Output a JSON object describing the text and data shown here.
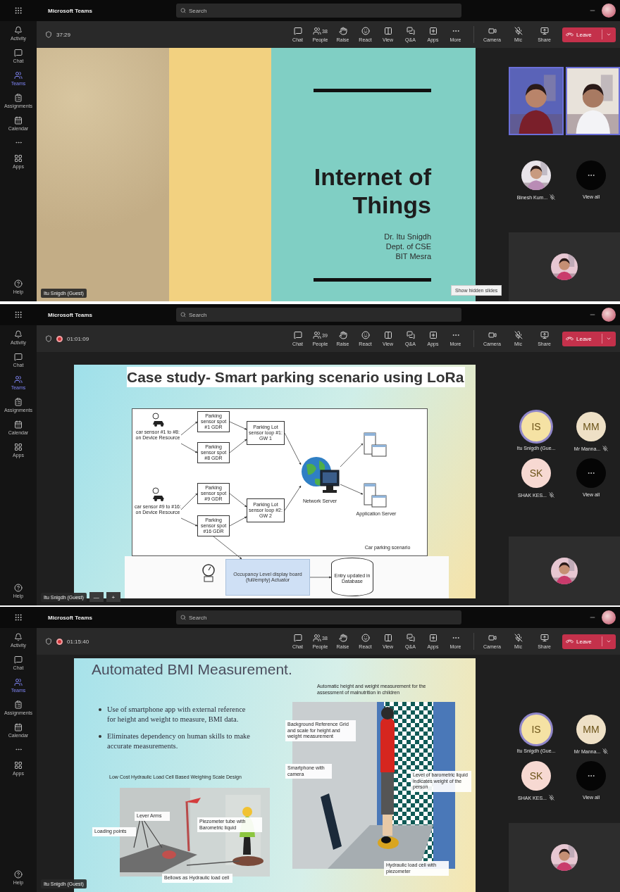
{
  "screens": [
    {
      "app_title": "Microsoft Teams",
      "search": {
        "placeholder": "Search"
      },
      "rail": [
        {
          "kind": "bell",
          "label": "Activity",
          "selected": false
        },
        {
          "kind": "chat",
          "label": "Chat",
          "selected": false
        },
        {
          "kind": "teams",
          "label": "Teams",
          "selected": true
        },
        {
          "kind": "assign",
          "label": "Assignments",
          "selected": false
        },
        {
          "kind": "calendar",
          "label": "Calendar",
          "selected": false
        },
        {
          "kind": "more",
          "selected": false
        },
        {
          "kind": "apps",
          "label": "Apps",
          "selected": false
        },
        {
          "kind": "help",
          "label": "Help",
          "selected": false
        }
      ],
      "call": {
        "recording": false,
        "timer": "37:29",
        "actions": [
          {
            "kind": "chat",
            "label": "Chat"
          },
          {
            "kind": "people",
            "label": "People",
            "count": "38"
          },
          {
            "kind": "raise",
            "label": "Raise"
          },
          {
            "kind": "react",
            "label": "React"
          },
          {
            "kind": "view",
            "label": "View"
          },
          {
            "kind": "qa",
            "label": "Q&A"
          },
          {
            "kind": "apps",
            "label": "Apps"
          },
          {
            "kind": "more",
            "label": "More"
          }
        ],
        "devices": [
          {
            "kind": "camera",
            "label": "Camera"
          },
          {
            "kind": "mic",
            "label": "Mic"
          },
          {
            "kind": "share",
            "label": "Share"
          }
        ],
        "leave": "Leave"
      },
      "stage": {
        "slide": {
          "kind": "title",
          "title_lines": [
            "Internet of",
            "Things"
          ],
          "subtitle_lines": [
            "Dr. Itu Snigdh",
            "Dept. of CSE",
            "BIT Mesra"
          ]
        },
        "presenter": "Itu Snigdh (Guest)",
        "hint": "Show hidden slides"
      },
      "side": {
        "participants": [
          {
            "name": "Binesh Kum...",
            "muted": true,
            "speaking": false
          },
          {
            "kind": "overflow",
            "name": "View all"
          }
        ]
      }
    },
    {
      "app_title": "Microsoft Teams",
      "search": {
        "placeholder": "Search"
      },
      "rail": [
        {
          "kind": "bell",
          "label": "Activity",
          "selected": false
        },
        {
          "kind": "chat",
          "label": "Chat",
          "selected": false
        },
        {
          "kind": "teams",
          "label": "Teams",
          "selected": true
        },
        {
          "kind": "assign",
          "label": "Assignments",
          "selected": false
        },
        {
          "kind": "calendar",
          "label": "Calendar",
          "selected": false
        },
        {
          "kind": "apps",
          "label": "Apps",
          "selected": false
        },
        {
          "kind": "help",
          "label": "Help",
          "selected": false
        }
      ],
      "call": {
        "recording": true,
        "timer": "01:01:09",
        "actions": [
          {
            "kind": "chat",
            "label": "Chat"
          },
          {
            "kind": "people",
            "label": "People",
            "count": "39"
          },
          {
            "kind": "raise",
            "label": "Raise"
          },
          {
            "kind": "react",
            "label": "React"
          },
          {
            "kind": "view",
            "label": "View"
          },
          {
            "kind": "qa",
            "label": "Q&A"
          },
          {
            "kind": "apps",
            "label": "Apps"
          },
          {
            "kind": "more",
            "label": "More"
          }
        ],
        "devices": [
          {
            "kind": "camera",
            "label": "Camera"
          },
          {
            "kind": "mic",
            "label": "Mic"
          },
          {
            "kind": "share",
            "label": "Share"
          }
        ],
        "leave": "Leave"
      },
      "stage": {
        "slide": {
          "kind": "diagram",
          "title": "Case study- Smart parking scenario using LoRa",
          "diagram": {
            "groups": [
              {
                "car_label": "car sensor #1 to #8: on Device Resource",
                "sensors": [
                  "Parking sensor spot #1 GDR",
                  "Parking sensor spot #8 GDR"
                ],
                "gateway": "Parking Lot sensor loop #1: GW 1"
              },
              {
                "car_label": "car sensor #9 to #16: on Device Resource",
                "sensors": [
                  "Parking sensor spot #9 GDR",
                  "Parking sensor spot #16 GDR"
                ],
                "gateway": "Parking Lot sensor loop #2: GW 2"
              }
            ],
            "network_server": "Network Server",
            "application_server": "Application Server",
            "caption": "Car parking scenario",
            "display_board": "Occupancy Level display board (full/empty) Actuator",
            "database": "Entry updated in Database"
          }
        },
        "presenter": "Itu Snigdh (Guest)",
        "zoom_controls": [
          "—",
          "+"
        ]
      },
      "side": {
        "participants": [
          {
            "kind": "initials",
            "initials": "IS",
            "name": "Itu Snigdh (Gue...",
            "muted": false,
            "speaking": true,
            "color": "#f5e2a4"
          },
          {
            "kind": "initials",
            "initials": "MM",
            "name": "Mr Manna...",
            "muted": true,
            "speaking": false,
            "color": "#eee0c6"
          },
          {
            "kind": "initials",
            "initials": "SK",
            "name": "SHAK KES...",
            "muted": true,
            "speaking": false,
            "color": "#f7d9d2"
          },
          {
            "kind": "overflow",
            "name": "View all"
          }
        ]
      }
    },
    {
      "app_title": "Microsoft Teams",
      "search": {
        "placeholder": "Search"
      },
      "rail": [
        {
          "kind": "bell",
          "label": "Activity",
          "selected": false
        },
        {
          "kind": "chat",
          "label": "Chat",
          "selected": false
        },
        {
          "kind": "teams",
          "label": "Teams",
          "selected": true
        },
        {
          "kind": "assign",
          "label": "Assignments",
          "selected": false
        },
        {
          "kind": "calendar",
          "label": "Calendar",
          "selected": false
        },
        {
          "kind": "more",
          "selected": false
        },
        {
          "kind": "apps",
          "label": "Apps",
          "selected": false
        },
        {
          "kind": "help",
          "label": "Help",
          "selected": false
        }
      ],
      "call": {
        "recording": true,
        "timer": "01:15:40",
        "actions": [
          {
            "kind": "chat",
            "label": "Chat"
          },
          {
            "kind": "people",
            "label": "People",
            "count": "38"
          },
          {
            "kind": "raise",
            "label": "Raise"
          },
          {
            "kind": "react",
            "label": "React"
          },
          {
            "kind": "view",
            "label": "View"
          },
          {
            "kind": "qa",
            "label": "Q&A"
          },
          {
            "kind": "apps",
            "label": "Apps"
          },
          {
            "kind": "more",
            "label": "More"
          }
        ],
        "devices": [
          {
            "kind": "camera",
            "label": "Camera"
          },
          {
            "kind": "mic",
            "label": "Mic"
          },
          {
            "kind": "share",
            "label": "Share"
          }
        ],
        "leave": "Leave"
      },
      "stage": {
        "slide": {
          "kind": "bmi",
          "title": "Automated BMI Measurement.",
          "bullets": [
            "Use of smartphone app with external reference for height and weight to measure, BMI data.",
            "Eliminates dependency on human skills to make accurate measurements."
          ],
          "caption": "Low Cost Hydraulic Load Cell Based Weighing Scale Design",
          "figure_caption": "Automatic height and weight measurement for the assessment of malnutrition in children",
          "labels": [
            "Background Reference Grid and scale for height and weight measurement",
            "Smartphone with camera",
            "Level of barometric liquid indicates weight of the person",
            "Hydraulic load cell with piezometer",
            "Lever Arms",
            "Loading points",
            "Piezometer tube with Barometric liquid",
            "Bellows as Hydraulic load cell"
          ]
        },
        "presenter": "Itu Snigdh (Guest)"
      },
      "side": {
        "participants": [
          {
            "kind": "initials",
            "initials": "IS",
            "name": "Itu Snigdh (Gue...",
            "muted": false,
            "speaking": true,
            "color": "#f5e2a4"
          },
          {
            "kind": "initials",
            "initials": "MM",
            "name": "Mr Manna...",
            "muted": true,
            "speaking": false,
            "color": "#eee0c6"
          },
          {
            "kind": "initials",
            "initials": "SK",
            "name": "SHAK KES...",
            "muted": true,
            "speaking": false,
            "color": "#f7d9d2"
          },
          {
            "kind": "overflow",
            "name": "View all"
          }
        ]
      }
    }
  ]
}
